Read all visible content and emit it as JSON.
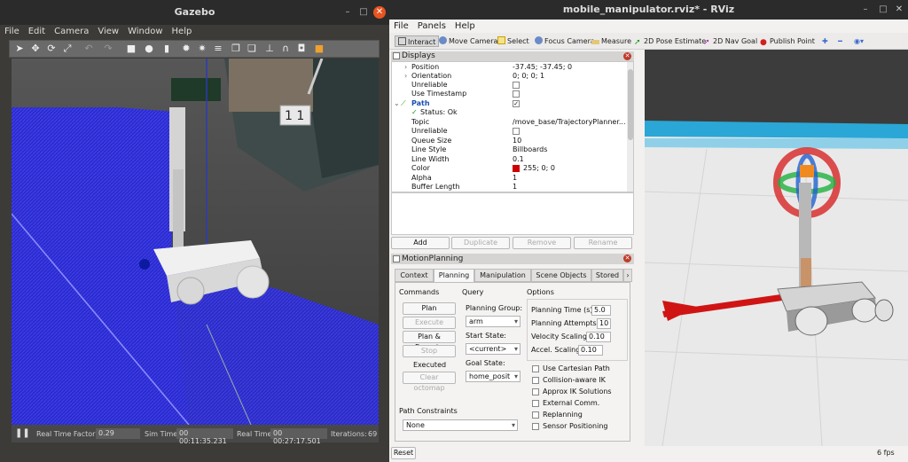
{
  "gazebo": {
    "title": "Gazebo",
    "menu": [
      "File",
      "Edit",
      "Camera",
      "View",
      "Window",
      "Help"
    ],
    "cube_label": "1 1",
    "status": {
      "rtf_label": "Real Time Factor:",
      "rtf_value": "0.29",
      "sim_label": "Sim Time:",
      "sim_value": "00 00:11:35.231",
      "real_label": "Real Time:",
      "real_value": "00 00:27:17.501",
      "iter_label": "Iterations:",
      "iter_value": "69"
    }
  },
  "rviz": {
    "title": "mobile_manipulator.rviz* - RViz",
    "menu": [
      "File",
      "Panels",
      "Help"
    ],
    "toolbar": [
      "Interact",
      "Move Camera",
      "Select",
      "Focus Camera",
      "Measure",
      "2D Pose Estimate",
      "2D Nav Goal",
      "Publish Point"
    ],
    "displays": {
      "header": "Displays",
      "rows": [
        {
          "k": "Position",
          "v": "-37.45; -37.45; 0"
        },
        {
          "k": "Orientation",
          "v": "0; 0; 0; 1"
        },
        {
          "k": "Unreliable",
          "v": ""
        },
        {
          "k": "Use Timestamp",
          "v": ""
        },
        {
          "k": "Path",
          "v": ""
        },
        {
          "k": "Status: Ok",
          "v": ""
        },
        {
          "k": "Topic",
          "v": "/move_base/TrajectoryPlanner..."
        },
        {
          "k": "Unreliable",
          "v": ""
        },
        {
          "k": "Queue Size",
          "v": "10"
        },
        {
          "k": "Line Style",
          "v": "Billboards"
        },
        {
          "k": "Line Width",
          "v": "0.1"
        },
        {
          "k": "Color",
          "v": "255; 0; 0"
        },
        {
          "k": "Alpha",
          "v": "1"
        },
        {
          "k": "Buffer Length",
          "v": "1"
        }
      ],
      "buttons": [
        "Add",
        "Duplicate",
        "Remove",
        "Rename"
      ]
    },
    "motion": {
      "header": "MotionPlanning",
      "tabs": [
        "Context",
        "Planning",
        "Manipulation",
        "Scene Objects",
        "Stored"
      ],
      "commands_label": "Commands",
      "query_label": "Query",
      "options_label": "Options",
      "cmd_buttons": [
        "Plan",
        "Execute",
        "Plan & Execute",
        "Stop"
      ],
      "executed": "Executed",
      "clear_octomap": "Clear octomap",
      "planning_group_label": "Planning Group:",
      "planning_group": "arm",
      "start_state_label": "Start State:",
      "start_state": "<current>",
      "goal_state_label": "Goal State:",
      "goal_state": "home_posit",
      "opts": [
        {
          "label": "Planning Time (s):",
          "value": "5.0"
        },
        {
          "label": "Planning Attempts:",
          "value": "10"
        },
        {
          "label": "Velocity Scaling:",
          "value": "0.10"
        },
        {
          "label": "Accel. Scaling:",
          "value": "0.10"
        }
      ],
      "checks": [
        "Use Cartesian Path",
        "Collision-aware IK",
        "Approx IK Solutions",
        "External Comm.",
        "Replanning",
        "Sensor Positioning"
      ],
      "path_constraints_label": "Path Constraints",
      "path_constraints": "None"
    },
    "reset": "Reset",
    "fps": "6 fps"
  }
}
